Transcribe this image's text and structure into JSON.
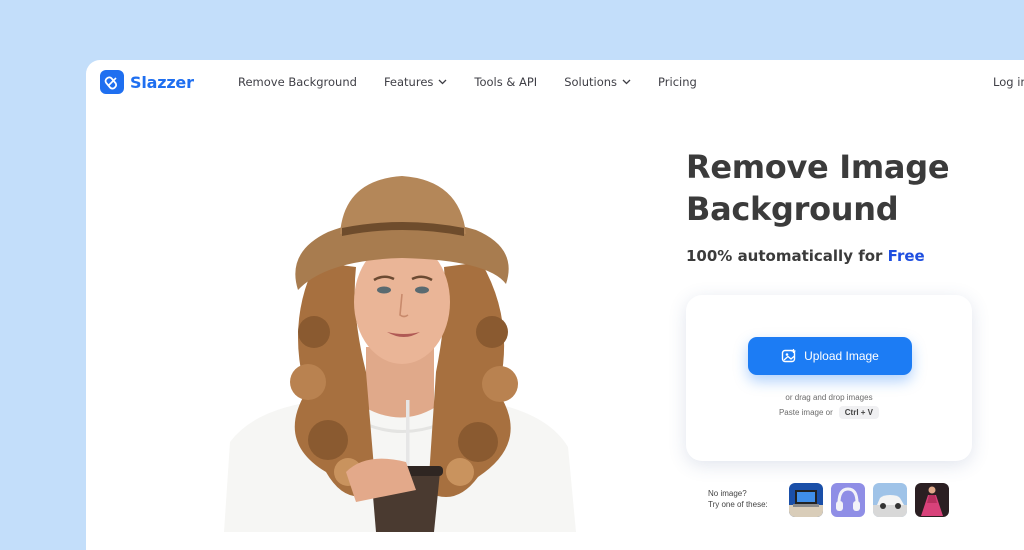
{
  "brand": {
    "name": "Slazzer",
    "color": "#1f6ff0",
    "icon": "slazzer-logo-icon"
  },
  "nav": {
    "items": [
      {
        "label": "Remove Background",
        "dropdown": false
      },
      {
        "label": "Features",
        "dropdown": true
      },
      {
        "label": "Tools & API",
        "dropdown": false
      },
      {
        "label": "Solutions",
        "dropdown": true
      },
      {
        "label": "Pricing",
        "dropdown": false
      }
    ],
    "login_label": "Log in"
  },
  "hero": {
    "title_line1": "Remove Image",
    "title_line2": "Background",
    "subtitle_prefix": "100% automatically for",
    "subtitle_highlight": "Free"
  },
  "upload": {
    "button_label": "Upload Image",
    "button_icon": "image-upload-icon",
    "drag_text": "or drag and drop images",
    "paste_text": "Paste image or",
    "shortcut": "Ctrl + V"
  },
  "samples": {
    "line1": "No image?",
    "line2": "Try one of these:",
    "items": [
      {
        "name": "laptop-sample-thumbnail"
      },
      {
        "name": "headphones-sample-thumbnail"
      },
      {
        "name": "car-sample-thumbnail"
      },
      {
        "name": "dress-sample-thumbnail"
      }
    ]
  },
  "colors": {
    "page_bg": "#c3defa",
    "accent": "#1c7cf4",
    "highlight": "#1f4fe0"
  }
}
